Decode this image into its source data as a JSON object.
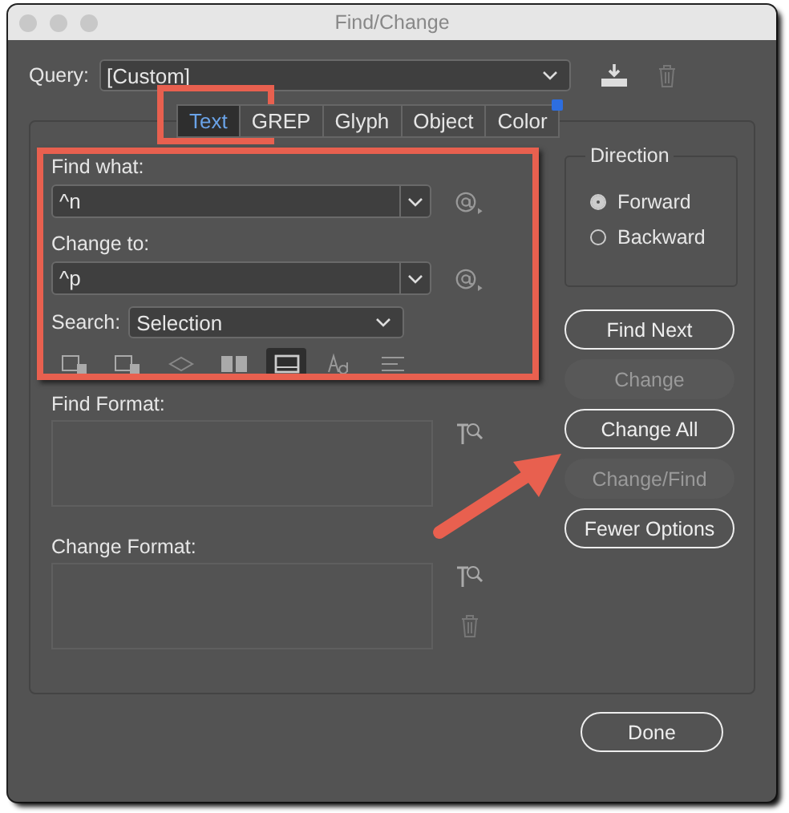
{
  "window": {
    "title": "Find/Change"
  },
  "query": {
    "label": "Query:",
    "value": "[Custom]"
  },
  "tabs": [
    {
      "label": "Text",
      "selected": true,
      "badge": false
    },
    {
      "label": "GREP",
      "selected": false,
      "badge": false
    },
    {
      "label": "Glyph",
      "selected": false,
      "badge": false
    },
    {
      "label": "Object",
      "selected": false,
      "badge": false
    },
    {
      "label": "Color",
      "selected": false,
      "badge": true
    }
  ],
  "find_what": {
    "label": "Find what:",
    "value": "^n"
  },
  "change_to": {
    "label": "Change to:",
    "value": "^p"
  },
  "search": {
    "label": "Search:",
    "value": "Selection"
  },
  "search_options": [
    {
      "kind": "locked-layers",
      "selected": false
    },
    {
      "kind": "locked-stories",
      "selected": false
    },
    {
      "kind": "hidden-layers",
      "selected": false
    },
    {
      "kind": "master-pages",
      "selected": false
    },
    {
      "kind": "footnotes",
      "selected": true
    },
    {
      "kind": "case",
      "selected": false
    },
    {
      "kind": "whole-word",
      "selected": false
    }
  ],
  "find_format": {
    "label": "Find Format:"
  },
  "change_format": {
    "label": "Change Format:"
  },
  "direction": {
    "label": "Direction",
    "options": [
      {
        "label": "Forward",
        "selected": true
      },
      {
        "label": "Backward",
        "selected": false
      }
    ]
  },
  "buttons": [
    {
      "label": "Find Next",
      "disabled": false
    },
    {
      "label": "Change",
      "disabled": true
    },
    {
      "label": "Change All",
      "disabled": false
    },
    {
      "label": "Change/Find",
      "disabled": true
    },
    {
      "label": "Fewer Options",
      "disabled": false
    }
  ],
  "done_button": "Done",
  "annotations": [
    {
      "kind": "tab-box"
    },
    {
      "kind": "fields-box"
    },
    {
      "kind": "arrow"
    }
  ]
}
